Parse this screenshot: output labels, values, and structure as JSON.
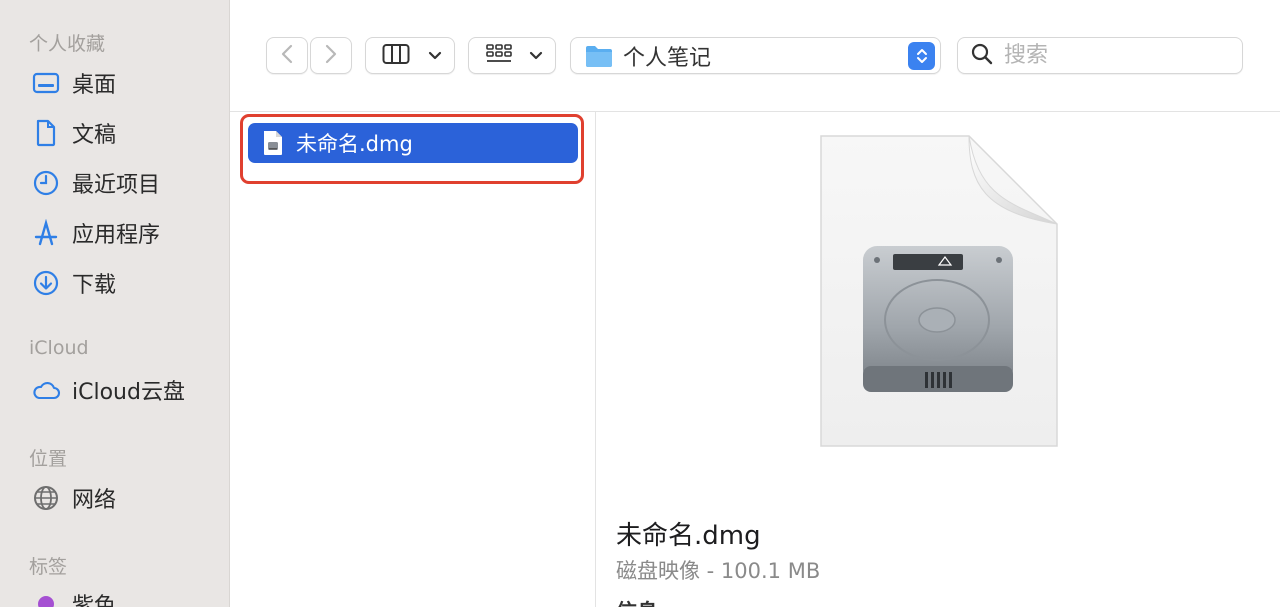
{
  "sidebar": {
    "sections": {
      "favorites": "个人收藏",
      "icloud": "iCloud",
      "locations": "位置",
      "tags": "标签"
    },
    "favorites": [
      {
        "label": "桌面",
        "icon": "desktop-icon"
      },
      {
        "label": "文稿",
        "icon": "document-icon"
      },
      {
        "label": "最近项目",
        "icon": "clock-icon"
      },
      {
        "label": "应用程序",
        "icon": "applications-icon"
      },
      {
        "label": "下载",
        "icon": "download-icon"
      }
    ],
    "icloud_items": [
      {
        "label": "iCloud云盘",
        "icon": "cloud-icon"
      }
    ],
    "location_items": [
      {
        "label": "网络",
        "icon": "globe-icon"
      }
    ],
    "tag_items": [
      {
        "label": "紫色",
        "color": "#a550d2"
      }
    ]
  },
  "toolbar": {
    "path_label": "个人笔记",
    "search_placeholder": "搜索",
    "accent": "#3b82f0"
  },
  "file_list": {
    "selected_file": "未命名.dmg",
    "selection_color": "#2b62d9",
    "annotation_color": "#e0402f"
  },
  "preview": {
    "file_name": "未命名.dmg",
    "kind_size": "磁盘映像 - 100.1 MB",
    "info_heading": "信息"
  }
}
